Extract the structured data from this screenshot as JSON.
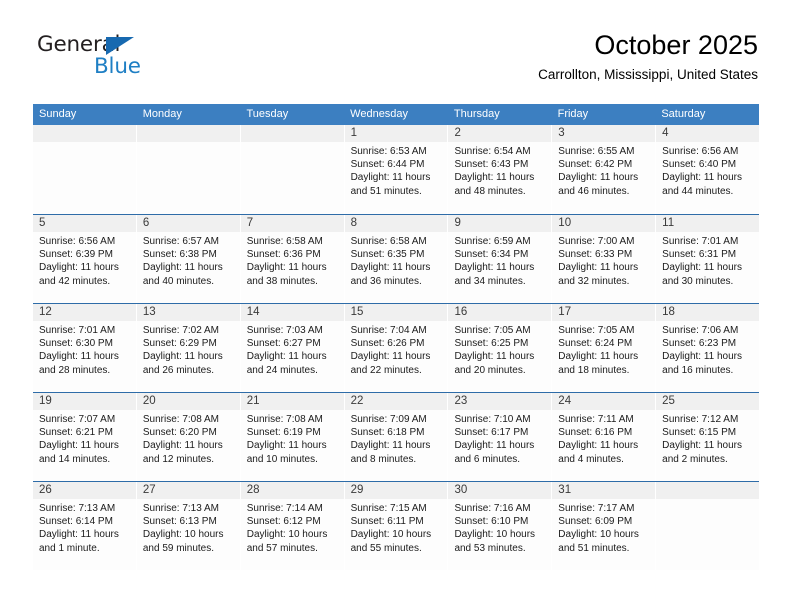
{
  "brand": {
    "name_top": "General",
    "name_bottom": "Blue",
    "triangle_color": "#1769b0",
    "blue_color": "#1f7fc4"
  },
  "header": {
    "title": "October 2025",
    "subtitle": "Carrollton, Mississippi, United States"
  },
  "colors": {
    "header_row": "#3c7fc1",
    "week_divider": "#2e6ca8",
    "day_number_bar": "#f0f0f0"
  },
  "weekdays": [
    "Sunday",
    "Monday",
    "Tuesday",
    "Wednesday",
    "Thursday",
    "Friday",
    "Saturday"
  ],
  "weeks": [
    [
      {
        "day": "",
        "empty": true
      },
      {
        "day": "",
        "empty": true
      },
      {
        "day": "",
        "empty": true
      },
      {
        "day": "1",
        "sunrise": "Sunrise: 6:53 AM",
        "sunset": "Sunset: 6:44 PM",
        "daylight": "Daylight: 11 hours and 51 minutes."
      },
      {
        "day": "2",
        "sunrise": "Sunrise: 6:54 AM",
        "sunset": "Sunset: 6:43 PM",
        "daylight": "Daylight: 11 hours and 48 minutes."
      },
      {
        "day": "3",
        "sunrise": "Sunrise: 6:55 AM",
        "sunset": "Sunset: 6:42 PM",
        "daylight": "Daylight: 11 hours and 46 minutes."
      },
      {
        "day": "4",
        "sunrise": "Sunrise: 6:56 AM",
        "sunset": "Sunset: 6:40 PM",
        "daylight": "Daylight: 11 hours and 44 minutes."
      }
    ],
    [
      {
        "day": "5",
        "sunrise": "Sunrise: 6:56 AM",
        "sunset": "Sunset: 6:39 PM",
        "daylight": "Daylight: 11 hours and 42 minutes."
      },
      {
        "day": "6",
        "sunrise": "Sunrise: 6:57 AM",
        "sunset": "Sunset: 6:38 PM",
        "daylight": "Daylight: 11 hours and 40 minutes."
      },
      {
        "day": "7",
        "sunrise": "Sunrise: 6:58 AM",
        "sunset": "Sunset: 6:36 PM",
        "daylight": "Daylight: 11 hours and 38 minutes."
      },
      {
        "day": "8",
        "sunrise": "Sunrise: 6:58 AM",
        "sunset": "Sunset: 6:35 PM",
        "daylight": "Daylight: 11 hours and 36 minutes."
      },
      {
        "day": "9",
        "sunrise": "Sunrise: 6:59 AM",
        "sunset": "Sunset: 6:34 PM",
        "daylight": "Daylight: 11 hours and 34 minutes."
      },
      {
        "day": "10",
        "sunrise": "Sunrise: 7:00 AM",
        "sunset": "Sunset: 6:33 PM",
        "daylight": "Daylight: 11 hours and 32 minutes."
      },
      {
        "day": "11",
        "sunrise": "Sunrise: 7:01 AM",
        "sunset": "Sunset: 6:31 PM",
        "daylight": "Daylight: 11 hours and 30 minutes."
      }
    ],
    [
      {
        "day": "12",
        "sunrise": "Sunrise: 7:01 AM",
        "sunset": "Sunset: 6:30 PM",
        "daylight": "Daylight: 11 hours and 28 minutes."
      },
      {
        "day": "13",
        "sunrise": "Sunrise: 7:02 AM",
        "sunset": "Sunset: 6:29 PM",
        "daylight": "Daylight: 11 hours and 26 minutes."
      },
      {
        "day": "14",
        "sunrise": "Sunrise: 7:03 AM",
        "sunset": "Sunset: 6:27 PM",
        "daylight": "Daylight: 11 hours and 24 minutes."
      },
      {
        "day": "15",
        "sunrise": "Sunrise: 7:04 AM",
        "sunset": "Sunset: 6:26 PM",
        "daylight": "Daylight: 11 hours and 22 minutes."
      },
      {
        "day": "16",
        "sunrise": "Sunrise: 7:05 AM",
        "sunset": "Sunset: 6:25 PM",
        "daylight": "Daylight: 11 hours and 20 minutes."
      },
      {
        "day": "17",
        "sunrise": "Sunrise: 7:05 AM",
        "sunset": "Sunset: 6:24 PM",
        "daylight": "Daylight: 11 hours and 18 minutes."
      },
      {
        "day": "18",
        "sunrise": "Sunrise: 7:06 AM",
        "sunset": "Sunset: 6:23 PM",
        "daylight": "Daylight: 11 hours and 16 minutes."
      }
    ],
    [
      {
        "day": "19",
        "sunrise": "Sunrise: 7:07 AM",
        "sunset": "Sunset: 6:21 PM",
        "daylight": "Daylight: 11 hours and 14 minutes."
      },
      {
        "day": "20",
        "sunrise": "Sunrise: 7:08 AM",
        "sunset": "Sunset: 6:20 PM",
        "daylight": "Daylight: 11 hours and 12 minutes."
      },
      {
        "day": "21",
        "sunrise": "Sunrise: 7:08 AM",
        "sunset": "Sunset: 6:19 PM",
        "daylight": "Daylight: 11 hours and 10 minutes."
      },
      {
        "day": "22",
        "sunrise": "Sunrise: 7:09 AM",
        "sunset": "Sunset: 6:18 PM",
        "daylight": "Daylight: 11 hours and 8 minutes."
      },
      {
        "day": "23",
        "sunrise": "Sunrise: 7:10 AM",
        "sunset": "Sunset: 6:17 PM",
        "daylight": "Daylight: 11 hours and 6 minutes."
      },
      {
        "day": "24",
        "sunrise": "Sunrise: 7:11 AM",
        "sunset": "Sunset: 6:16 PM",
        "daylight": "Daylight: 11 hours and 4 minutes."
      },
      {
        "day": "25",
        "sunrise": "Sunrise: 7:12 AM",
        "sunset": "Sunset: 6:15 PM",
        "daylight": "Daylight: 11 hours and 2 minutes."
      }
    ],
    [
      {
        "day": "26",
        "sunrise": "Sunrise: 7:13 AM",
        "sunset": "Sunset: 6:14 PM",
        "daylight": "Daylight: 11 hours and 1 minute."
      },
      {
        "day": "27",
        "sunrise": "Sunrise: 7:13 AM",
        "sunset": "Sunset: 6:13 PM",
        "daylight": "Daylight: 10 hours and 59 minutes."
      },
      {
        "day": "28",
        "sunrise": "Sunrise: 7:14 AM",
        "sunset": "Sunset: 6:12 PM",
        "daylight": "Daylight: 10 hours and 57 minutes."
      },
      {
        "day": "29",
        "sunrise": "Sunrise: 7:15 AM",
        "sunset": "Sunset: 6:11 PM",
        "daylight": "Daylight: 10 hours and 55 minutes."
      },
      {
        "day": "30",
        "sunrise": "Sunrise: 7:16 AM",
        "sunset": "Sunset: 6:10 PM",
        "daylight": "Daylight: 10 hours and 53 minutes."
      },
      {
        "day": "31",
        "sunrise": "Sunrise: 7:17 AM",
        "sunset": "Sunset: 6:09 PM",
        "daylight": "Daylight: 10 hours and 51 minutes."
      },
      {
        "day": "",
        "empty": true
      }
    ]
  ]
}
